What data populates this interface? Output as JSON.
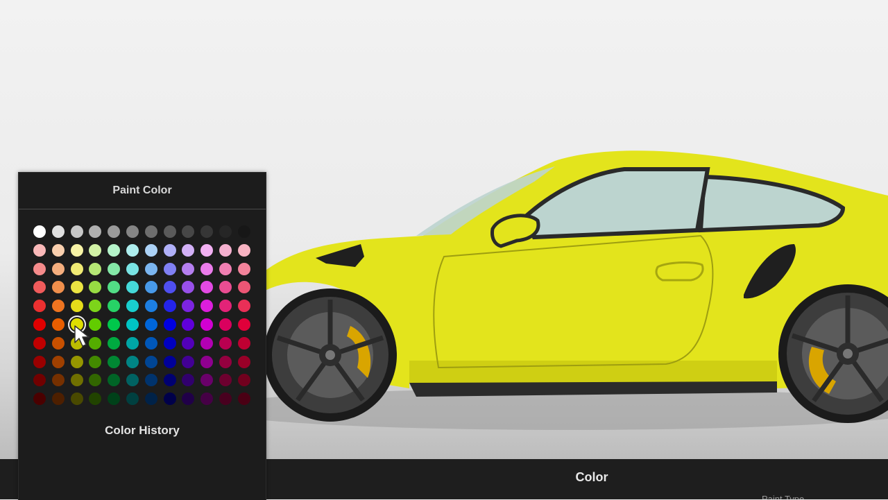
{
  "panel": {
    "title": "Paint Color",
    "history_title": "Color History"
  },
  "bottom_bar": {
    "title": "Color",
    "hint": "Paint Type"
  },
  "selected": {
    "row": 5,
    "col": 2
  },
  "car_colors": {
    "body": "#e3e41c",
    "body_shade": "#c6c60f",
    "caliper": "#d9a500",
    "wheel": "#3d3d3d",
    "tire": "#1b1b1b",
    "glass": "#bcd4cf"
  },
  "palette": [
    [
      "#ffffff",
      "#e0e0e0",
      "#c7c7c7",
      "#b0b0b0",
      "#9a9a9a",
      "#858585",
      "#6e6e6e",
      "#5a5a5a",
      "#474747",
      "#363636",
      "#262626",
      "#171717"
    ],
    [
      "#f9b8b8",
      "#f9cfae",
      "#f7f3a6",
      "#d2f2a6",
      "#b5f3c9",
      "#aeeeee",
      "#acd2f6",
      "#b0b0f8",
      "#d2b0f6",
      "#f2b0f2",
      "#f5b0cf",
      "#f8b3c2"
    ],
    [
      "#f58b8b",
      "#f5ae7e",
      "#f0ea74",
      "#b6e775",
      "#84e8a7",
      "#79e3e3",
      "#7bb6f0",
      "#8080f4",
      "#b57ff0",
      "#eb7ceb",
      "#f07fb2",
      "#f3839b"
    ],
    [
      "#f05b5b",
      "#f08f4c",
      "#ebe442",
      "#98dc43",
      "#52dd86",
      "#45d9d9",
      "#489ae9",
      "#4f4ff0",
      "#9850e9",
      "#e44ae4",
      "#ea4d92",
      "#ed5675"
    ],
    [
      "#eb3030",
      "#ee7420",
      "#e6dd1a",
      "#7dd41a",
      "#27d266",
      "#19cece",
      "#1d7fe2",
      "#2424ea",
      "#7c24e2",
      "#dc1edc",
      "#e32378",
      "#e92f57"
    ],
    [
      "#e00000",
      "#e85e00",
      "#dede00",
      "#62cc00",
      "#00c74b",
      "#00c4c4",
      "#0066da",
      "#0000e0",
      "#6000da",
      "#d200d2",
      "#da005e",
      "#e0003a"
    ],
    [
      "#c00000",
      "#c85000",
      "#bdbd00",
      "#54ad00",
      "#00a940",
      "#00a6a6",
      "#0057b9",
      "#0000bf",
      "#5200b9",
      "#b300b3",
      "#b90050",
      "#bf0032"
    ],
    [
      "#990000",
      "#9f4000",
      "#969600",
      "#438a00",
      "#008733",
      "#008484",
      "#004594",
      "#000099",
      "#420094",
      "#8f008f",
      "#94003f",
      "#990028"
    ],
    [
      "#710000",
      "#763000",
      "#707000",
      "#326600",
      "#006426",
      "#006262",
      "#00336d",
      "#000071",
      "#31006d",
      "#6a006a",
      "#6d002f",
      "#71001e"
    ],
    [
      "#4a0000",
      "#4d1f00",
      "#494900",
      "#214300",
      "#004119",
      "#004040",
      "#002248",
      "#00004a",
      "#200048",
      "#450045",
      "#48001f",
      "#4a0014"
    ]
  ]
}
